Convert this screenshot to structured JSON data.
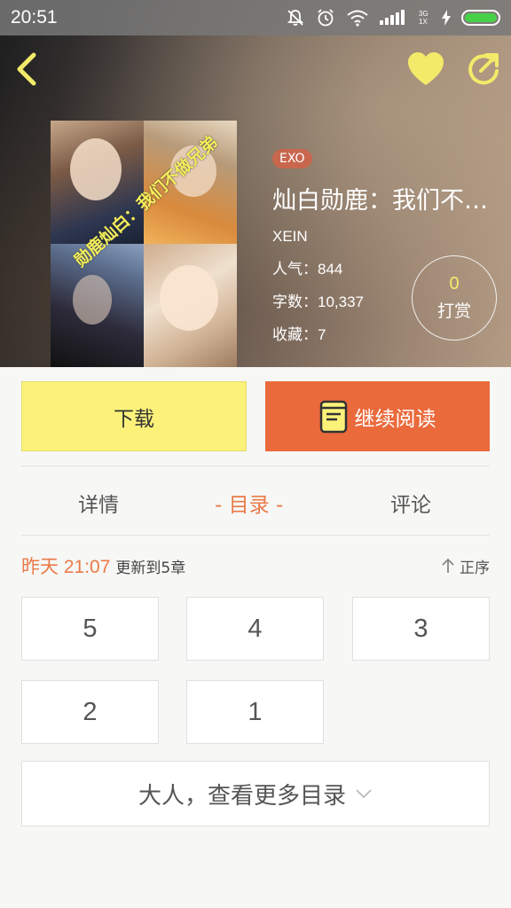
{
  "status_bar": {
    "time": "20:51",
    "network_label": "3G 1X",
    "battery_color": "#47d048"
  },
  "header": {
    "back_icon": "chevron-left-icon",
    "favorite_icon": "heart-icon",
    "share_icon": "share-icon",
    "accent_color": "#f3ea6a"
  },
  "book": {
    "tag": "EXO",
    "title": "灿白勋鹿：我们不…",
    "author": "XEIN",
    "popularity_label": "人气：",
    "popularity_value": "844",
    "word_count_label": "字数：",
    "word_count_value": "10,337",
    "favorites_label": "收藏：",
    "favorites_value": "7",
    "cover_caption": "勋鹿灿白：我们不做兄弟"
  },
  "tip": {
    "count": "0",
    "label": "打赏"
  },
  "actions": {
    "download_label": "下载",
    "continue_label": "继续阅读",
    "download_color": "#fcf27a",
    "continue_color": "#ea6a3c"
  },
  "tabs": {
    "details": "详情",
    "contents": "- 目录 -",
    "comments": "评论"
  },
  "update": {
    "time": "昨天 21:07",
    "text": "更新到5章",
    "sort_label": "正序"
  },
  "chapters": [
    "5",
    "4",
    "3",
    "2",
    "1"
  ],
  "more_contents_label": "大人，查看更多目录"
}
